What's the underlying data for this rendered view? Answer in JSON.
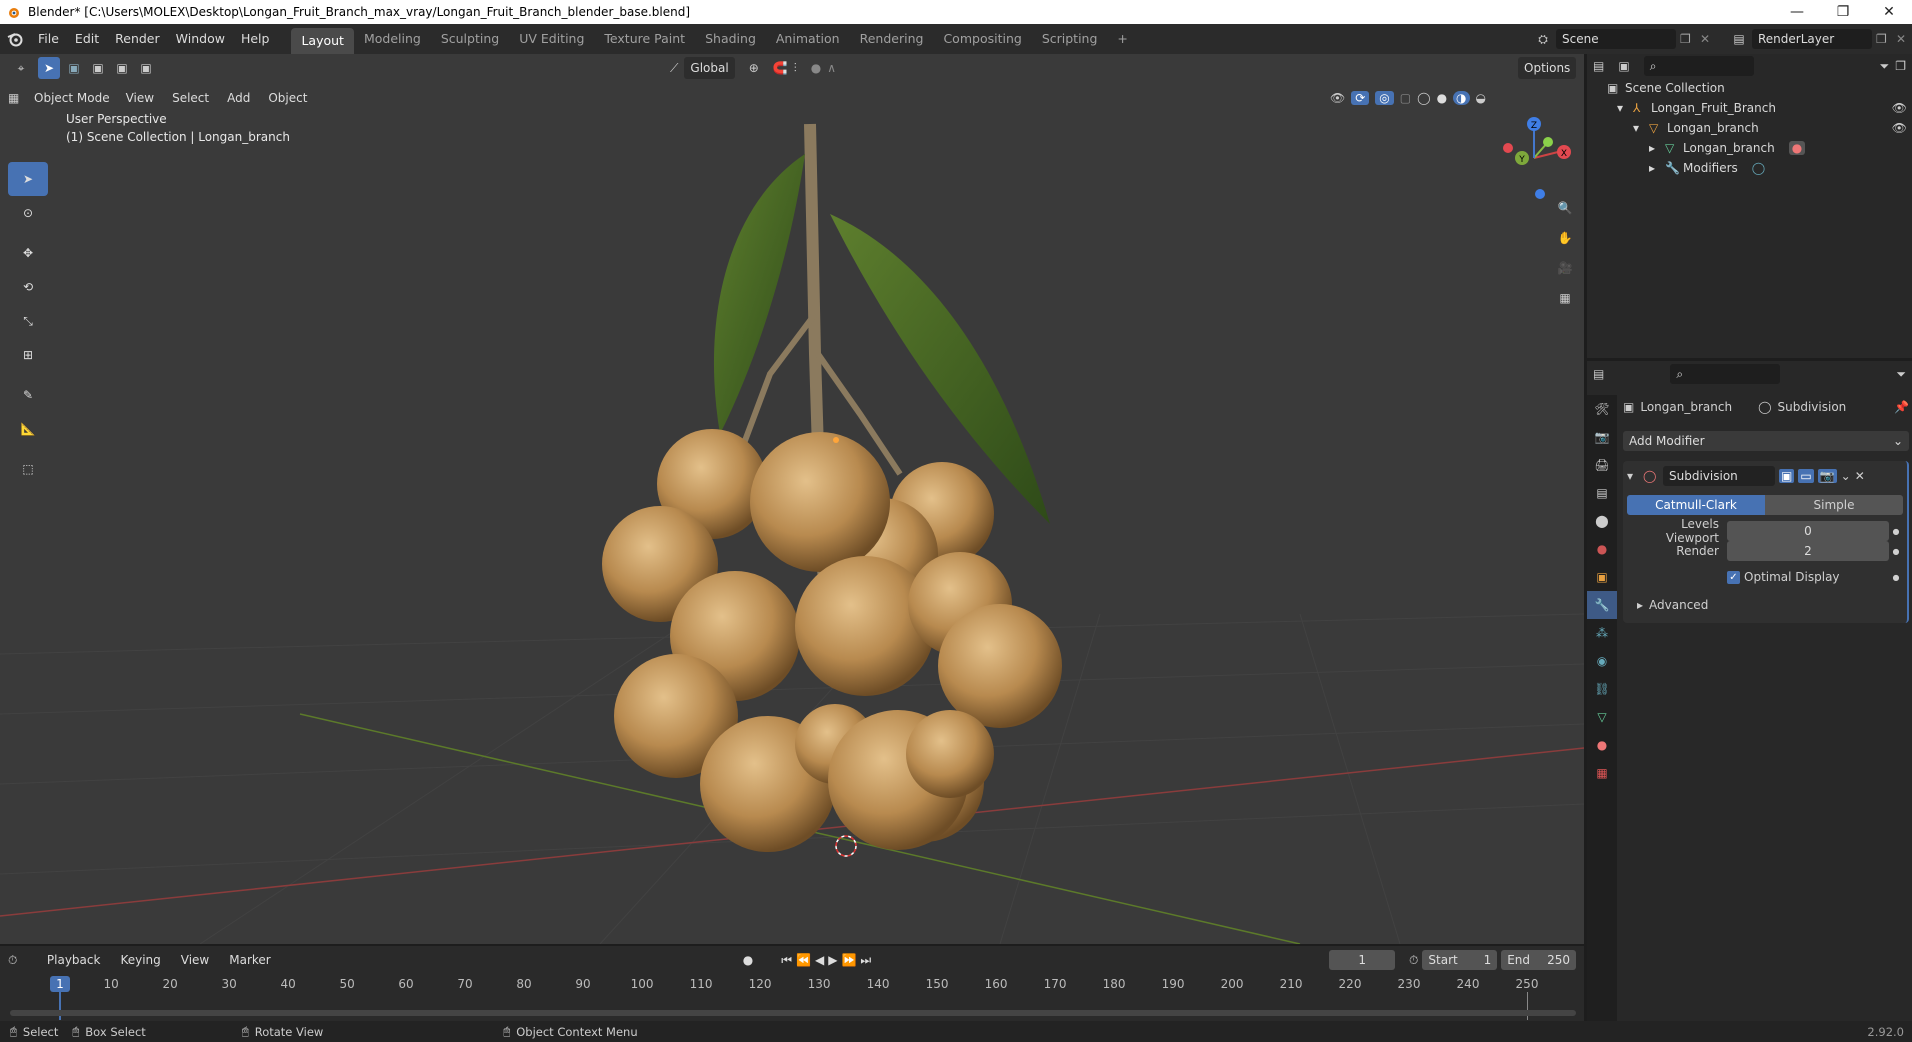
{
  "window": {
    "title": "Blender* [C:\\Users\\MOLEX\\Desktop\\Longan_Fruit_Branch_max_vray/Longan_Fruit_Branch_blender_base.blend]",
    "minimize": "—",
    "restore": "❐",
    "close": "✕"
  },
  "menubar": {
    "items": [
      "File",
      "Edit",
      "Render",
      "Window",
      "Help"
    ],
    "workspaces": [
      "Layout",
      "Modeling",
      "Sculpting",
      "UV Editing",
      "Texture Paint",
      "Shading",
      "Animation",
      "Rendering",
      "Compositing",
      "Scripting"
    ],
    "add_ws": "+",
    "scene": "Scene",
    "render_layer": "RenderLayer"
  },
  "viewport": {
    "transform_orientation": "Global",
    "options": "Options",
    "mode": "Object Mode",
    "menus": [
      "View",
      "Select",
      "Add",
      "Object"
    ],
    "info_line1": "User Perspective",
    "info_line2": "(1) Scene Collection | Longan_branch",
    "gizmo": {
      "x": "X",
      "y": "Y",
      "z": "Z"
    }
  },
  "outliner": {
    "root": "Scene Collection",
    "items": [
      {
        "label": "Longan_Fruit_Branch",
        "indent": 1
      },
      {
        "label": "Longan_branch",
        "indent": 2
      },
      {
        "label": "Longan_branch",
        "indent": 3
      },
      {
        "label": "Modifiers",
        "indent": 3
      }
    ]
  },
  "properties": {
    "object": "Longan_branch",
    "modifier_name": "Subdivision",
    "add_modifier": "Add Modifier",
    "mod_field": "Subdivision",
    "catmull": "Catmull-Clark",
    "simple": "Simple",
    "levels_viewport_label": "Levels Viewport",
    "levels_viewport": "0",
    "render_label": "Render",
    "render_value": "2",
    "optimal_display": "Optimal Display",
    "advanced": "Advanced"
  },
  "timeline": {
    "menus": [
      "Playback",
      "Keying",
      "View",
      "Marker"
    ],
    "current_frame": "1",
    "start_label": "Start",
    "start": "1",
    "end_label": "End",
    "end": "250",
    "ticks": [
      "1",
      "10",
      "20",
      "30",
      "40",
      "50",
      "60",
      "70",
      "80",
      "90",
      "100",
      "110",
      "120",
      "130",
      "140",
      "150",
      "160",
      "170",
      "180",
      "190",
      "200",
      "210",
      "220",
      "230",
      "240",
      "250"
    ]
  },
  "status": {
    "select": "Select",
    "box_select": "Box Select",
    "rotate": "Rotate View",
    "context": "Object Context Menu",
    "version": "2.92.0"
  },
  "colors": {
    "accent": "#4772b3",
    "viewport_bg": "#3a3a3a",
    "panel_bg": "#282828"
  }
}
